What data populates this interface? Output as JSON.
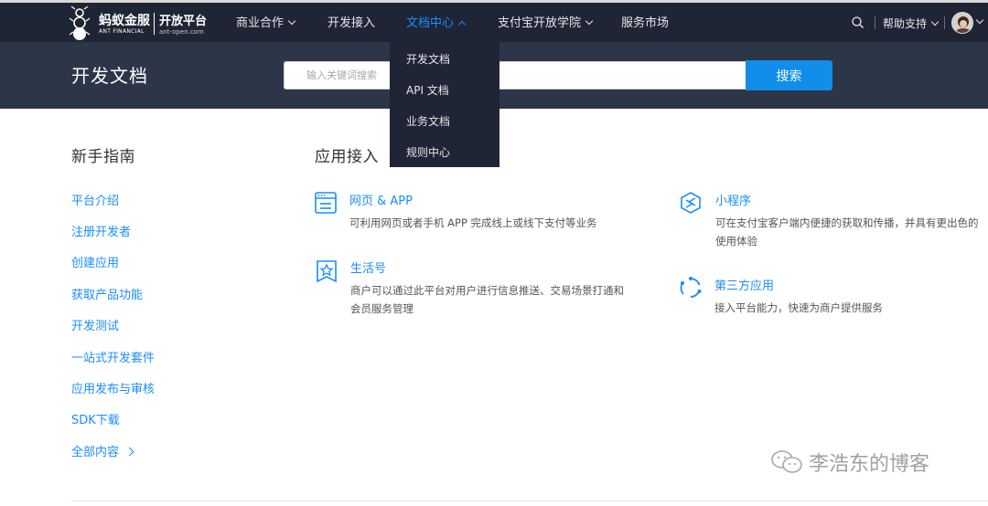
{
  "logo": {
    "name_cn": "蚂蚁金服",
    "name_en": "ANT FINANCIAL",
    "platform": "开放平台",
    "url": "ant-open.com"
  },
  "nav": {
    "items": [
      {
        "label": "商业合作",
        "has_chevron": true
      },
      {
        "label": "开发接入",
        "has_chevron": false
      },
      {
        "label": "文档中心",
        "has_chevron": true,
        "active": true
      },
      {
        "label": "支付宝开放学院",
        "has_chevron": true
      },
      {
        "label": "服务市场",
        "has_chevron": false
      }
    ],
    "help": "帮助支持",
    "active_color": "#1a8dff"
  },
  "dropdown": {
    "items": [
      "开发文档",
      "API 文档",
      "业务文档",
      "规则中心"
    ]
  },
  "hero": {
    "title": "开发文档",
    "search_placeholder": "输入关键词搜索",
    "search_button": "搜索"
  },
  "guide": {
    "title": "新手指南",
    "links": [
      "平台介绍",
      "注册开发者",
      "创建应用",
      "获取产品功能",
      "开发测试",
      "一站式开发套件",
      "应用发布与审核",
      "SDK下载"
    ],
    "more": "全部内容"
  },
  "access": {
    "title": "应用接入",
    "cards": [
      {
        "icon": "browser-window-icon",
        "title": "网页 & APP",
        "desc": "可利用网页或者手机 APP 完成线上或线下支付等业务"
      },
      {
        "icon": "mini-program-icon",
        "title": "小程序",
        "desc": "可在支付宝客户端内便捷的获取和传播，并具有更出色的使用体验"
      },
      {
        "icon": "star-badge-icon",
        "title": "生活号",
        "desc": "商户可以通过此平台对用户进行信息推送、交易场景打通和会员服务管理"
      },
      {
        "icon": "circle-refresh-icon",
        "title": "第三方应用",
        "desc": "接入平台能力，快速为商户提供服务"
      }
    ]
  },
  "watermark": "李浩东的博客",
  "colors": {
    "nav_bg": "#1f2535",
    "hero_bg": "#2d3548",
    "link": "#1a8dff",
    "button": "#108ee9"
  }
}
